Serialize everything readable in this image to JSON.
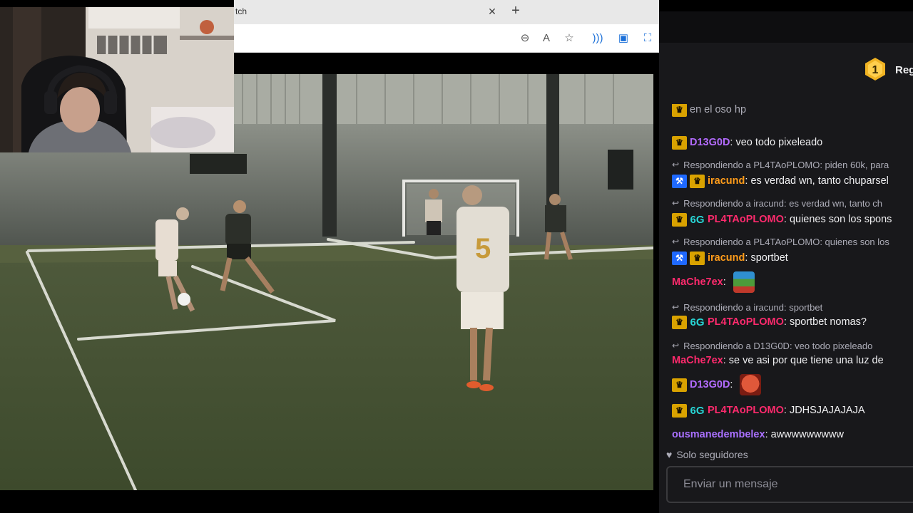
{
  "browser": {
    "tab_title_fragment": "tch",
    "tab_close_icon": "close-icon",
    "new_tab_icon": "plus-icon",
    "toolbar_icons": [
      "zoom-out-icon",
      "read-aloud-icon",
      "favorite-star-icon",
      "wifi-cast-icon",
      "extension-icon",
      "screenshot-icon"
    ]
  },
  "video": {
    "webcam_overlay": "streamer-webcam",
    "scene": "indoor-football-pitch",
    "player_number": "5"
  },
  "chat": {
    "rank_badge_number": "1",
    "rank_label": "Reg",
    "partial_top_line": "en el oso hp",
    "messages": [
      {
        "kind": "msg",
        "badges": [
          "crown"
        ],
        "user": "D13G0D",
        "user_color": "#b36bff",
        "text": "veo todo pixeleado"
      },
      {
        "kind": "reply",
        "text": "Respondiendo a PL4TAoPLOMO: piden 60k, para"
      },
      {
        "kind": "msg",
        "badges": [
          "hammer",
          "crown"
        ],
        "user": "iracund",
        "user_color": "#ff9c1a",
        "text": "es verdad wn, tanto chuparsel"
      },
      {
        "kind": "reply",
        "text": "Respondiendo a iracund: es verdad wn, tanto ch"
      },
      {
        "kind": "msg",
        "badges": [
          "crown",
          "sixg"
        ],
        "user": "PL4TAoPLOMO",
        "user_color": "#ff2a6d",
        "text": "quienes son los spons"
      },
      {
        "kind": "reply",
        "text": "Respondiendo a PL4TAoPLOMO: quienes son los"
      },
      {
        "kind": "msg",
        "badges": [
          "hammer",
          "crown"
        ],
        "user": "iracund",
        "user_color": "#ff9c1a",
        "text": "sportbet"
      },
      {
        "kind": "msg",
        "badges": [],
        "user": "MaChe7ex",
        "user_color": "#ff2a6d",
        "text": "",
        "emote": "pepe-sombrero-emote"
      },
      {
        "kind": "reply",
        "text": "Respondiendo a iracund: sportbet"
      },
      {
        "kind": "msg",
        "badges": [
          "crown",
          "sixg"
        ],
        "user": "PL4TAoPLOMO",
        "user_color": "#ff2a6d",
        "text": "sportbet nomas?"
      },
      {
        "kind": "reply",
        "text": "Respondiendo a D13G0D: veo todo pixeleado"
      },
      {
        "kind": "msg",
        "badges": [],
        "user": "MaChe7ex",
        "user_color": "#ff2a6d",
        "text": "se ve asi por que tiene una luz de"
      },
      {
        "kind": "msg",
        "badges": [
          "crown"
        ],
        "user": "D13G0D",
        "user_color": "#b36bff",
        "text": "",
        "emote": "red-face-emote"
      },
      {
        "kind": "msg",
        "badges": [
          "crown",
          "sixg"
        ],
        "user": "PL4TAoPLOMO",
        "user_color": "#ff2a6d",
        "text": "JDHSJAJAJAJA"
      },
      {
        "kind": "msg",
        "badges": [],
        "user": "ousmanedembelex",
        "user_color": "#a970ff",
        "text": "awwwwwwwww"
      }
    ],
    "followers_only_label": "Solo seguidores",
    "followers_only_icon": "heart-icon",
    "input_placeholder": "Enviar un mensaje"
  },
  "colors": {
    "chat_bg": "#18181b",
    "crown_badge": "#d9a200",
    "mod_badge": "#1f69ff",
    "reply_text": "#adadb8"
  }
}
